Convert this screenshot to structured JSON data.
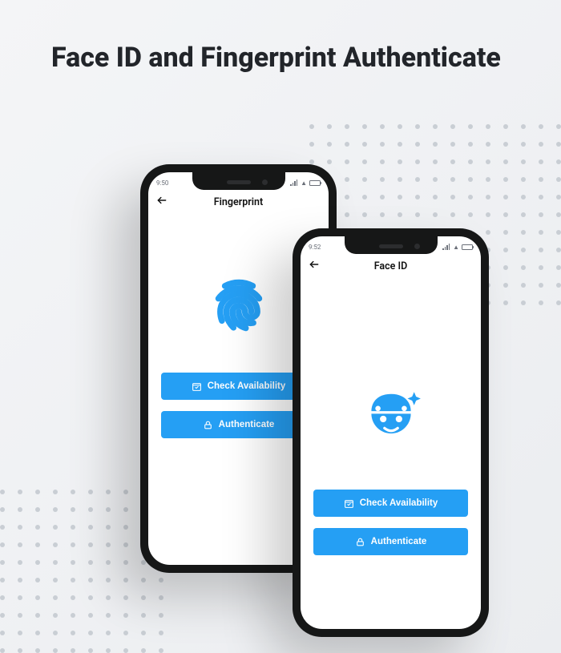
{
  "title": "Face ID and Fingerprint Authenticate",
  "brand_color": "#259ff4",
  "screens": {
    "fingerprint": {
      "statusbar_time": "9:50",
      "appbar_title": "Fingerprint",
      "icon": "fingerprint-icon",
      "buttons": {
        "check": {
          "label": "Check Availability",
          "icon": "calendar-check-icon"
        },
        "auth": {
          "label": "Authenticate",
          "icon": "lock-icon"
        }
      }
    },
    "faceid": {
      "statusbar_time": "9:52",
      "appbar_title": "Face ID",
      "icon": "face-icon",
      "buttons": {
        "check": {
          "label": "Check Availability",
          "icon": "calendar-check-icon"
        },
        "auth": {
          "label": "Authenticate",
          "icon": "lock-icon"
        }
      }
    }
  }
}
